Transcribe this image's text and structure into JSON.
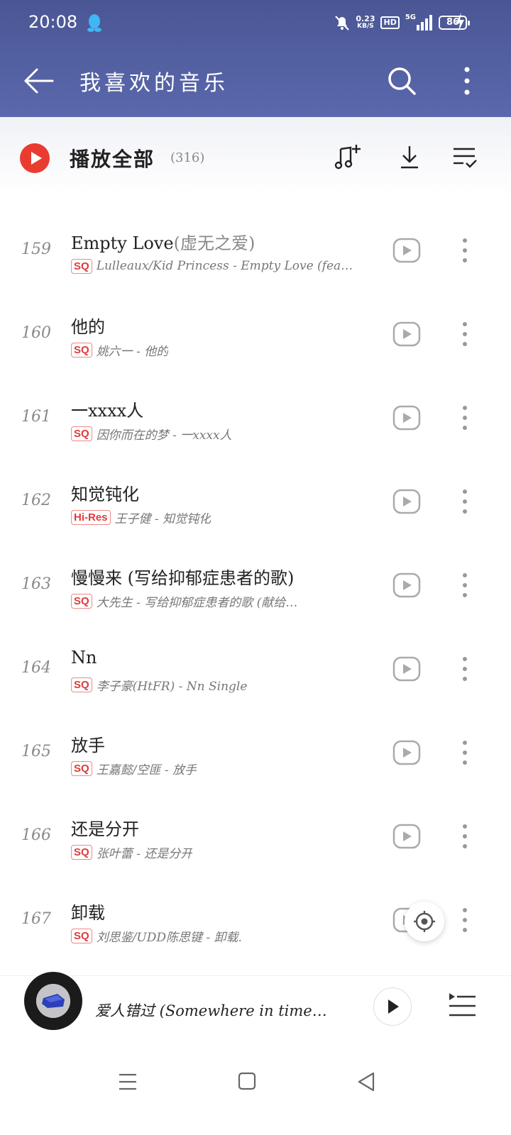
{
  "status_bar": {
    "time": "20:08",
    "net_speed_value": "0.23",
    "net_speed_unit": "KB/S",
    "hd_label": "HD",
    "signal_label": "5G",
    "battery": "86"
  },
  "header": {
    "title": "我喜欢的音乐"
  },
  "play_all": {
    "label": "播放全部",
    "count": "(316)"
  },
  "songs": [
    {
      "index": "159",
      "title": "Empty Love",
      "title_extra": "(虚无之爱)",
      "quality": "SQ",
      "artist_album": "Lulleaux/Kid Princess - Empty Love (fea…"
    },
    {
      "index": "160",
      "title": "他的",
      "title_extra": "",
      "quality": "SQ",
      "artist_album": "姚六一 - 他的"
    },
    {
      "index": "161",
      "title": "一xxxx人",
      "title_extra": "",
      "quality": "SQ",
      "artist_album": "因你而在的梦 - 一xxxx人"
    },
    {
      "index": "162",
      "title": "知觉钝化",
      "title_extra": "",
      "quality": "Hi-Res",
      "artist_album": "王子健 - 知觉钝化"
    },
    {
      "index": "163",
      "title": "慢慢来 (写给抑郁症患者的歌)",
      "title_extra": "",
      "quality": "SQ",
      "artist_album": "大先生 - 写给抑郁症患者的歌 (献给…"
    },
    {
      "index": "164",
      "title": "Nn",
      "title_extra": "",
      "quality": "SQ",
      "artist_album": "李子豪(HtFR) - Nn  Single"
    },
    {
      "index": "165",
      "title": "放手",
      "title_extra": "",
      "quality": "SQ",
      "artist_album": "王嘉懿/空匪 - 放手"
    },
    {
      "index": "166",
      "title": "还是分开",
      "title_extra": "",
      "quality": "SQ",
      "artist_album": "张叶蕾 - 还是分开"
    },
    {
      "index": "167",
      "title": "卸载",
      "title_extra": "",
      "quality": "SQ",
      "artist_album": "刘思鉴/UDD陈思键 - 卸载."
    }
  ],
  "player": {
    "now_playing": "爱人错过 (Somewhere in time…"
  },
  "colors": {
    "header_bg": "#4a5694",
    "accent_red": "#ea3b31",
    "quality_badge": "#e03a3a"
  },
  "icons": {
    "back": "arrow-left-icon",
    "search": "search-icon",
    "more": "more-vertical-icon",
    "play_all": "play-circle-icon",
    "add_to_playlist": "music-add-icon",
    "download": "download-icon",
    "batch_manage": "list-check-icon",
    "mv": "video-play-icon",
    "locate": "locate-icon",
    "mini_play": "play-icon",
    "playlist": "playlist-icon"
  }
}
